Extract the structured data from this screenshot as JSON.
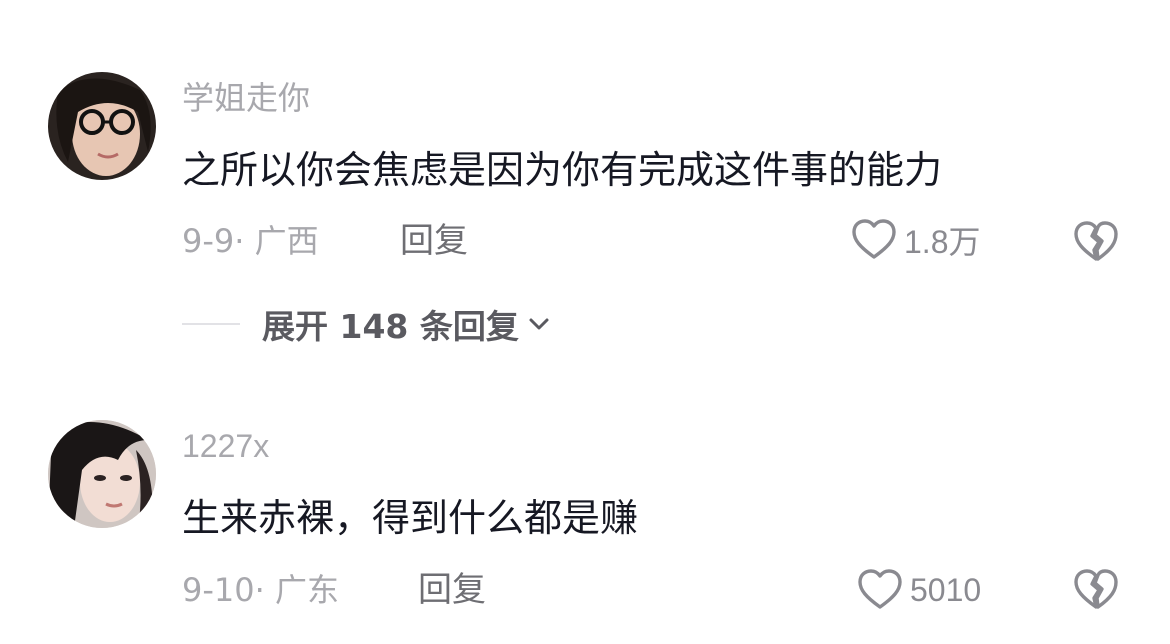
{
  "comments": [
    {
      "username": "学姐走你",
      "content": "之所以你会焦虑是因为你有完成这件事的能力",
      "date_location": "9-9· 广西",
      "reply_label": "回复",
      "likes": "1.8万",
      "expand_label": "展开 148 条回复"
    },
    {
      "username": "1227x",
      "content": "生来赤裸，得到什么都是赚",
      "date_location": "9-10· 广东",
      "reply_label": "回复",
      "likes": "5010"
    }
  ],
  "icons": {
    "like": "heart-outline-icon",
    "dislike": "broken-heart-icon",
    "expand": "chevron-down-icon"
  },
  "colors": {
    "text_primary": "#161823",
    "text_secondary": "#a8a8ad",
    "icon_gray": "#8a8a90"
  }
}
